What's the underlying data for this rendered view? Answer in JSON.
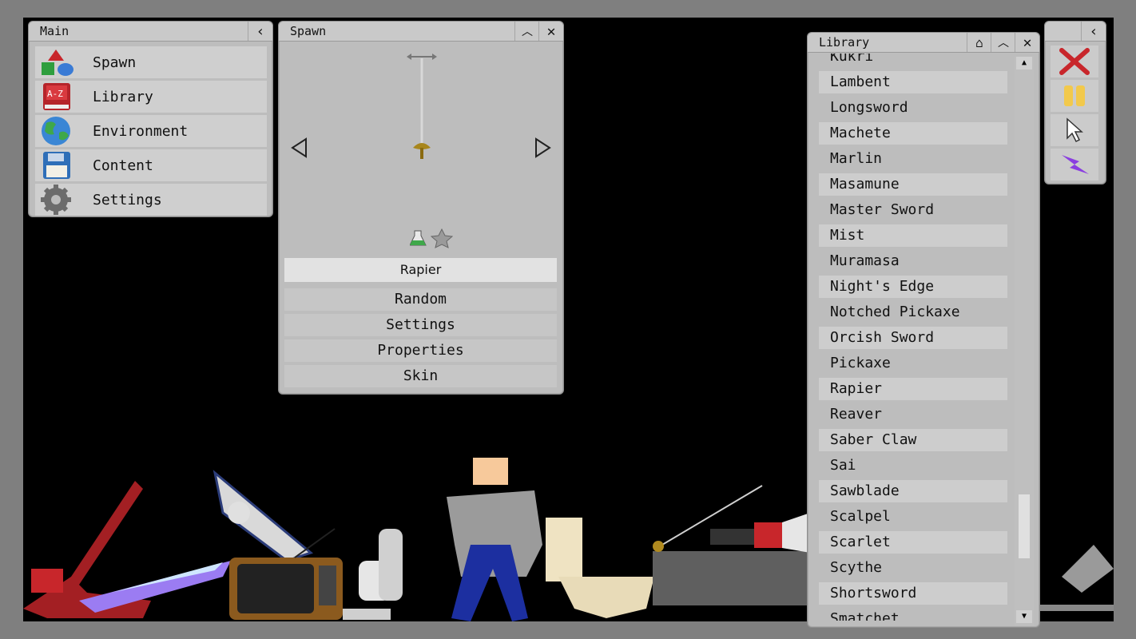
{
  "main": {
    "title": "Main",
    "items": [
      {
        "label": "Spawn",
        "icon": "shapes-icon"
      },
      {
        "label": "Library",
        "icon": "book-icon"
      },
      {
        "label": "Environment",
        "icon": "globe-icon"
      },
      {
        "label": "Content",
        "icon": "floppy-disk-icon"
      },
      {
        "label": "Settings",
        "icon": "gear-icon"
      }
    ]
  },
  "spawn": {
    "title": "Spawn",
    "selected_item": "Rapier",
    "buttons": [
      "Random",
      "Settings",
      "Properties",
      "Skin"
    ]
  },
  "library": {
    "title": "Library",
    "items": [
      "Kukri",
      "Lambent",
      "Longsword",
      "Machete",
      "Marlin",
      "Masamune",
      "Master Sword",
      "Mist",
      "Muramasa",
      "Night's Edge",
      "Notched Pickaxe",
      "Orcish Sword",
      "Pickaxe",
      "Rapier",
      "Reaver",
      "Saber Claw",
      "Sai",
      "Sawblade",
      "Scalpel",
      "Scarlet",
      "Scythe",
      "Shortsword",
      "Smatchet"
    ]
  },
  "tools": [
    "close-x-icon",
    "pause-icon",
    "cursor-icon",
    "lightning-icon"
  ],
  "colors": {
    "panel": "#bdbdbd",
    "background": "#000000",
    "frame": "#7f7f7f",
    "accent_red": "#c8262b",
    "pause_yellow": "#f2c94c",
    "lightning_purple": "#8a3ee0"
  }
}
